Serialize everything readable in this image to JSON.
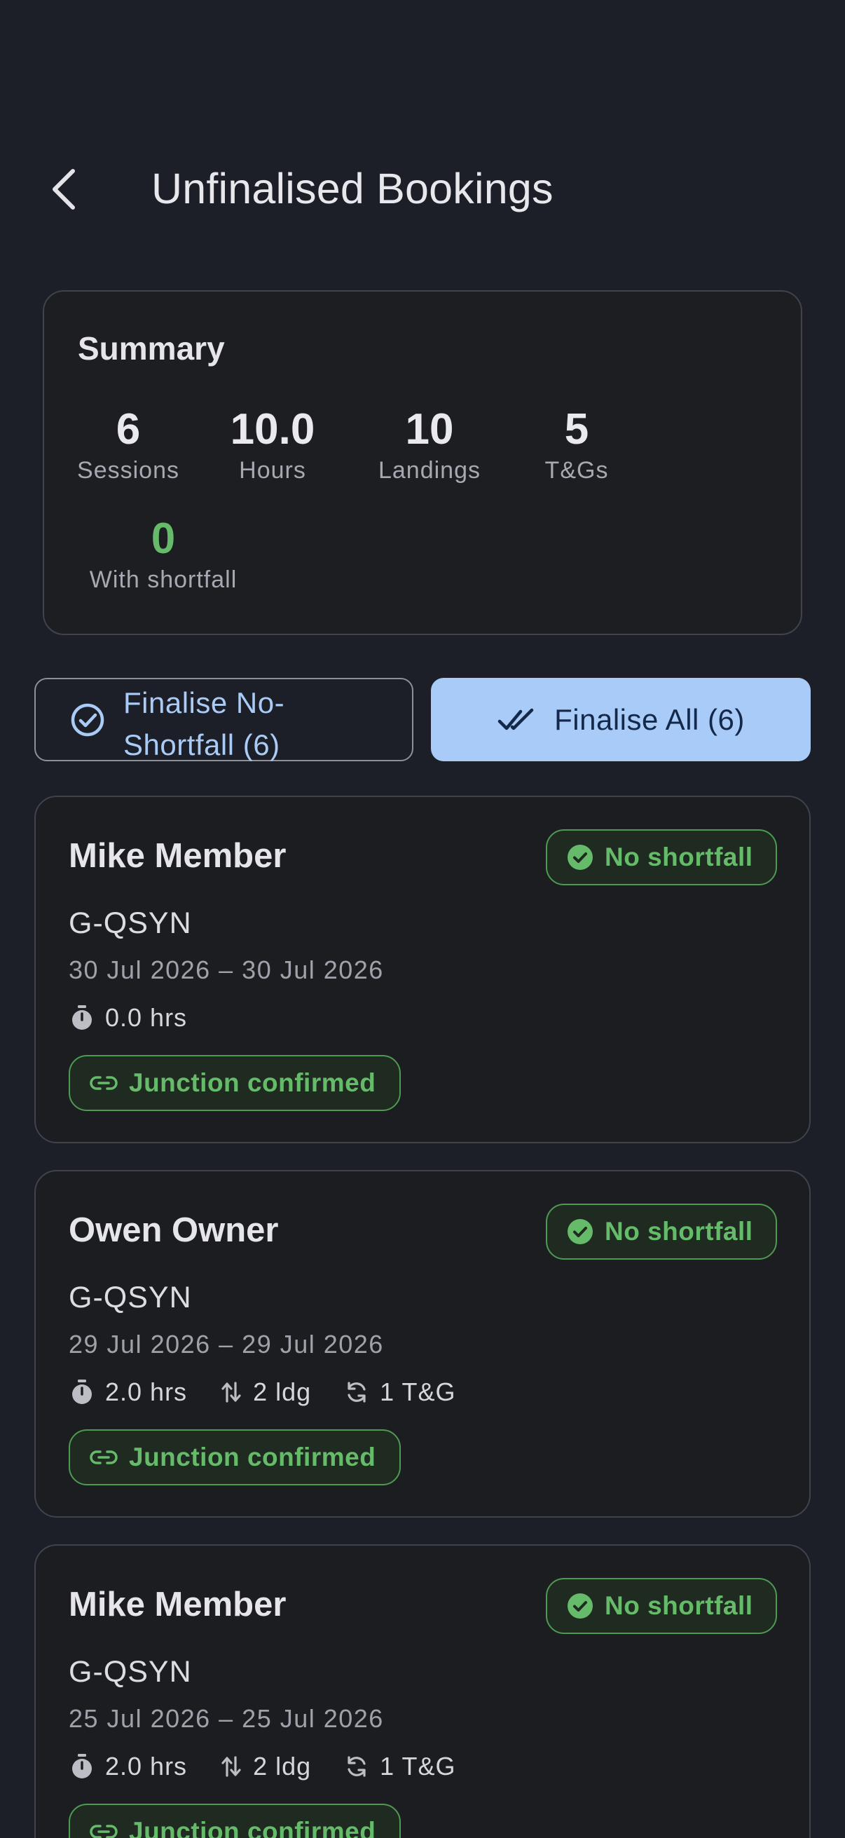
{
  "header": {
    "title": "Unfinalised Bookings"
  },
  "summary": {
    "title": "Summary",
    "stats": [
      {
        "value": "6",
        "label": "Sessions"
      },
      {
        "value": "10.0",
        "label": "Hours"
      },
      {
        "value": "10",
        "label": "Landings"
      },
      {
        "value": "5",
        "label": "T&Gs"
      },
      {
        "value": "0",
        "label": "With shortfall"
      }
    ]
  },
  "actions": {
    "finalise_no_shortfall": "Finalise No-Shortfall (6)",
    "finalise_all": "Finalise All (6)"
  },
  "bookings": [
    {
      "name": "Mike Member",
      "status": "No shortfall",
      "registration": "G-QSYN",
      "dates": "30 Jul 2026 – 30 Jul 2026",
      "hours": "0.0 hrs",
      "landings": "",
      "tgs": "",
      "junction": "Junction confirmed"
    },
    {
      "name": "Owen Owner",
      "status": "No shortfall",
      "registration": "G-QSYN",
      "dates": "29 Jul 2026 – 29 Jul 2026",
      "hours": "2.0 hrs",
      "landings": "2 ldg",
      "tgs": "1 T&G",
      "junction": "Junction confirmed"
    },
    {
      "name": "Mike Member",
      "status": "No shortfall",
      "registration": "G-QSYN",
      "dates": "25 Jul 2026 – 25 Jul 2026",
      "hours": "2.0 hrs",
      "landings": "2 ldg",
      "tgs": "1 T&G",
      "junction": "Junction confirmed"
    }
  ],
  "colors": {
    "background": "#1c1f27",
    "accent": "#a8cbf7",
    "success": "#66bb6a"
  }
}
